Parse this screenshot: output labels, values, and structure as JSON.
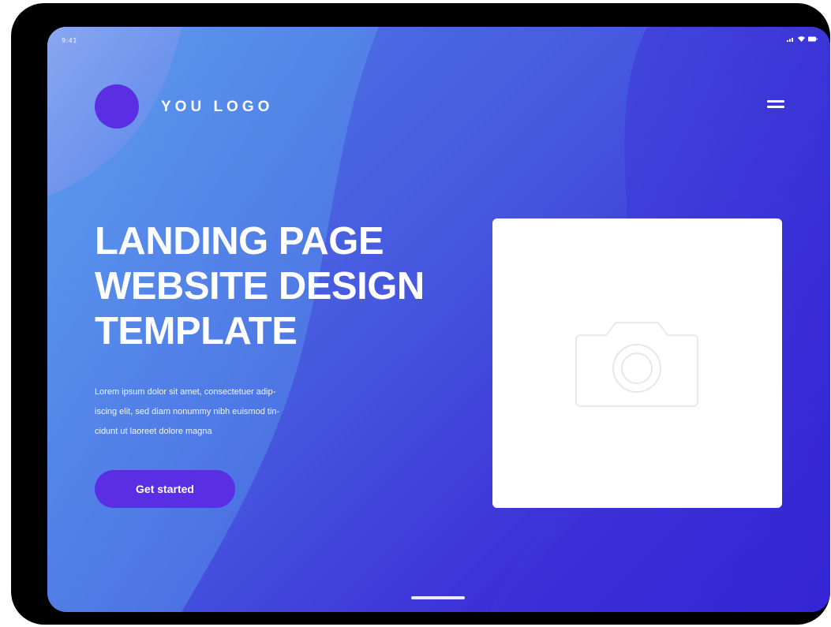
{
  "status_bar": {
    "time": "9:41",
    "icons": [
      "signal-icon",
      "wifi-icon",
      "battery-icon"
    ]
  },
  "header": {
    "logo_text": "YOU LOGO",
    "menu_icon": "hamburger-menu-icon"
  },
  "hero": {
    "headline_lines": [
      "LANDING PAGE",
      "WEBSITE DESIGN",
      "TEMPLATE"
    ],
    "body_lines": [
      "Lorem ipsum dolor sit amet, consectetuer adip-",
      "iscing elit, sed diam nonummy nibh euismod tin-",
      "cidunt ut laoreet dolore magna"
    ],
    "cta_label": "Get started"
  },
  "image_placeholder": {
    "icon": "camera-icon"
  },
  "colors": {
    "gradient_start": "#4f7fe6",
    "gradient_end": "#321fd3",
    "accent": "#5a2fe4",
    "card": "#ffffff",
    "text": "#ffffff"
  }
}
